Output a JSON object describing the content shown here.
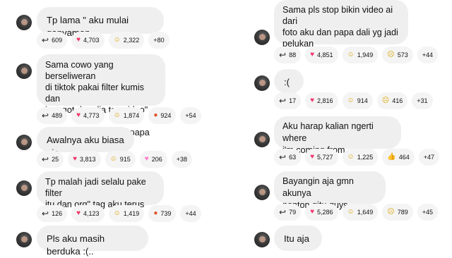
{
  "left": [
    {
      "text": "Tp lama \" aku mulai ganyaman",
      "replies": "609",
      "reactions": [
        {
          "icon": "heart",
          "count": "4,703"
        },
        {
          "icon": "laugh",
          "count": "2,322"
        }
      ],
      "more": "+80"
    },
    {
      "text": "Sama cowo yang berseliweran\ndi tiktok pakai filter kumis dan\njenggot dan dia tau video\" dia\nviral karna dblg mirip papa dali",
      "replies": "489",
      "reactions": [
        {
          "icon": "heart",
          "count": "4,773"
        },
        {
          "icon": "laugh",
          "count": "1,874"
        },
        {
          "icon": "angry",
          "count": "924"
        }
      ],
      "more": "+54"
    },
    {
      "text": "Awalnya aku biasa aja",
      "replies": "25",
      "reactions": [
        {
          "icon": "heart",
          "count": "3,813"
        },
        {
          "icon": "laugh",
          "count": "915"
        },
        {
          "icon": "pink-heart",
          "count": "206"
        }
      ],
      "more": "+38"
    },
    {
      "text": "Tp malah jadi selalu pake filter\nitu dan org\" tag aku terus",
      "replies": "126",
      "reactions": [
        {
          "icon": "heart",
          "count": "4,123"
        },
        {
          "icon": "laugh",
          "count": "1,419"
        },
        {
          "icon": "angry",
          "count": "739"
        }
      ],
      "more": "+44"
    },
    {
      "text": "Pls aku masih berduka :(.."
    }
  ],
  "right": [
    {
      "text": "Sama pls stop bikin video ai dari\nfoto aku dan papa dali yg jadi\npelukan",
      "replies": "88",
      "reactions": [
        {
          "icon": "heart",
          "count": "4,851"
        },
        {
          "icon": "laugh",
          "count": "1,949"
        },
        {
          "icon": "sad",
          "count": "573"
        }
      ],
      "more": "+44"
    },
    {
      "text": ":(",
      "replies": "17",
      "reactions": [
        {
          "icon": "heart",
          "count": "2,816"
        },
        {
          "icon": "laugh",
          "count": "914"
        },
        {
          "icon": "sad",
          "count": "416"
        }
      ],
      "more": "+31"
    },
    {
      "text": "Aku harap kalian ngerti where\ni'm coming from",
      "replies": "63",
      "reactions": [
        {
          "icon": "heart",
          "count": "5,727"
        },
        {
          "icon": "laugh",
          "count": "1,225"
        },
        {
          "icon": "thumbs-up",
          "count": "464"
        }
      ],
      "more": "+47"
    },
    {
      "text": "Bayangin aja gmn akunya\nnonton gitu guys",
      "replies": "79",
      "reactions": [
        {
          "icon": "heart",
          "count": "5,286"
        },
        {
          "icon": "laugh",
          "count": "1,649"
        },
        {
          "icon": "sad",
          "count": "789"
        }
      ],
      "more": "+45"
    },
    {
      "text": "Itu aja"
    }
  ]
}
